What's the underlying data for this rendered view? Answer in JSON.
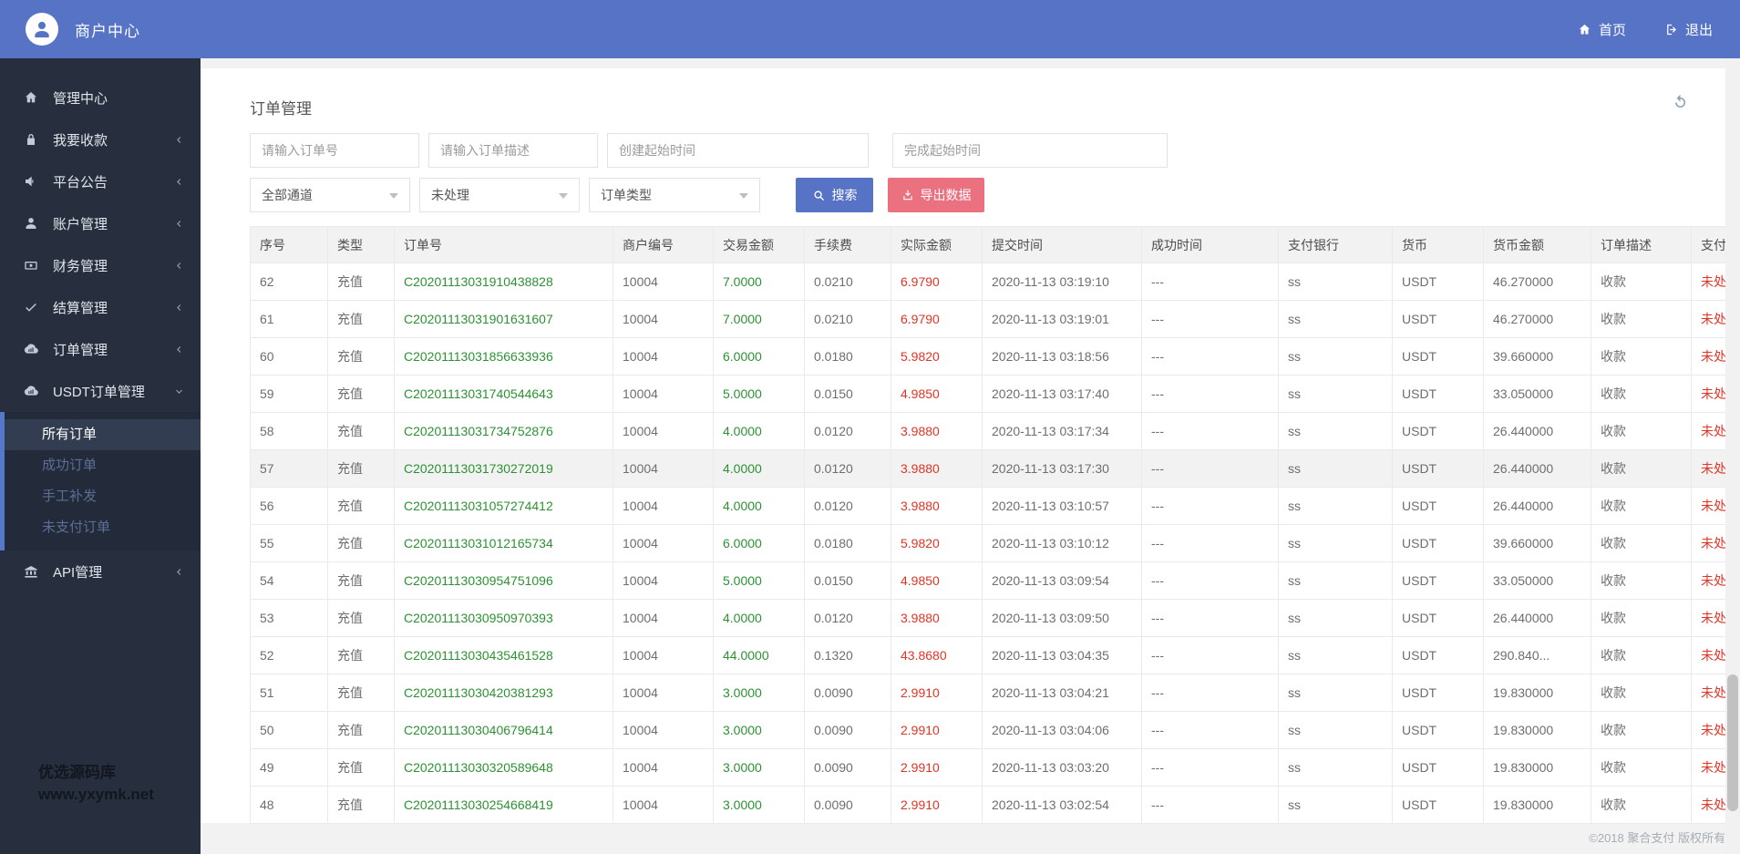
{
  "colors": {
    "header_blue": "#5673c5",
    "sidebar_bg": "#272e3d",
    "submenu_accent": "#5478ca",
    "link_green": "#2d9133",
    "alert_red": "#e03426",
    "export_pink": "#ec7180"
  },
  "header": {
    "brand": "商户中心",
    "nav": [
      {
        "id": "home",
        "label": "首页",
        "icon": "home-icon"
      },
      {
        "id": "logout",
        "label": "退出",
        "icon": "logout-icon"
      }
    ]
  },
  "sidebar": {
    "menu": [
      {
        "id": "management-center",
        "label": "管理中心",
        "icon": "home-icon",
        "arrow": ""
      },
      {
        "id": "receive-payment",
        "label": "我要收款",
        "icon": "lock-icon",
        "arrow": "left"
      },
      {
        "id": "platform-announcement",
        "label": "平台公告",
        "icon": "speaker-icon",
        "arrow": "left"
      },
      {
        "id": "account-management",
        "label": "账户管理",
        "icon": "user-icon",
        "arrow": "left"
      },
      {
        "id": "finance-management",
        "label": "财务管理",
        "icon": "money-icon",
        "arrow": "left"
      },
      {
        "id": "settlement-management",
        "label": "结算管理",
        "icon": "check-icon",
        "arrow": "left"
      },
      {
        "id": "order-management",
        "label": "订单管理",
        "icon": "cloud-icon",
        "arrow": "left"
      },
      {
        "id": "usdt-order-management",
        "label": "USDT订单管理",
        "icon": "cloud-icon",
        "arrow": "down",
        "children": [
          {
            "id": "all-orders",
            "label": "所有订单",
            "active": true
          },
          {
            "id": "success-orders",
            "label": "成功订单",
            "active": false
          },
          {
            "id": "manual-reissue",
            "label": "手工补发",
            "active": false
          },
          {
            "id": "unpaid-orders",
            "label": "未支付订单",
            "active": false
          }
        ]
      },
      {
        "id": "api-management",
        "label": "API管理",
        "icon": "bank-icon",
        "arrow": "left"
      }
    ],
    "watermark": {
      "line1": "优选源码库",
      "line2": "www.yxymk.net"
    }
  },
  "main": {
    "title": "订单管理",
    "filters": {
      "inputs": [
        {
          "id": "order-no",
          "placeholder": "请输入订单号"
        },
        {
          "id": "order-desc",
          "placeholder": "请输入订单描述"
        },
        {
          "id": "create-time",
          "placeholder": "创建起始时间"
        },
        {
          "id": "finish-time",
          "placeholder": "完成起始时间"
        }
      ],
      "selects": [
        {
          "id": "channel",
          "value": "全部通道"
        },
        {
          "id": "status",
          "value": "未处理"
        },
        {
          "id": "type",
          "value": "订单类型"
        }
      ],
      "search_label": "搜索",
      "export_label": "导出数据"
    },
    "table": {
      "columns": [
        "序号",
        "类型",
        "订单号",
        "商户编号",
        "交易金额",
        "手续费",
        "实际金额",
        "提交时间",
        "成功时间",
        "支付银行",
        "货币",
        "货币金额",
        "订单描述",
        "支付状态"
      ],
      "rows": [
        {
          "seq": "62",
          "type": "充值",
          "order_no": "C20201113031910438828",
          "merchant_no": "10004",
          "amount": "7.0000",
          "fee": "0.0210",
          "actual_amount": "6.9790",
          "submit_time": "2020-11-13 03:19:10",
          "success_time": "---",
          "bank": "ss",
          "currency": "USDT",
          "currency_amount": "46.270000",
          "description": "收款",
          "status": "未处理",
          "highlighted": false
        },
        {
          "seq": "61",
          "type": "充值",
          "order_no": "C20201113031901631607",
          "merchant_no": "10004",
          "amount": "7.0000",
          "fee": "0.0210",
          "actual_amount": "6.9790",
          "submit_time": "2020-11-13 03:19:01",
          "success_time": "---",
          "bank": "ss",
          "currency": "USDT",
          "currency_amount": "46.270000",
          "description": "收款",
          "status": "未处理",
          "highlighted": false
        },
        {
          "seq": "60",
          "type": "充值",
          "order_no": "C20201113031856633936",
          "merchant_no": "10004",
          "amount": "6.0000",
          "fee": "0.0180",
          "actual_amount": "5.9820",
          "submit_time": "2020-11-13 03:18:56",
          "success_time": "---",
          "bank": "ss",
          "currency": "USDT",
          "currency_amount": "39.660000",
          "description": "收款",
          "status": "未处理",
          "highlighted": false
        },
        {
          "seq": "59",
          "type": "充值",
          "order_no": "C20201113031740544643",
          "merchant_no": "10004",
          "amount": "5.0000",
          "fee": "0.0150",
          "actual_amount": "4.9850",
          "submit_time": "2020-11-13 03:17:40",
          "success_time": "---",
          "bank": "ss",
          "currency": "USDT",
          "currency_amount": "33.050000",
          "description": "收款",
          "status": "未处理",
          "highlighted": false
        },
        {
          "seq": "58",
          "type": "充值",
          "order_no": "C20201113031734752876",
          "merchant_no": "10004",
          "amount": "4.0000",
          "fee": "0.0120",
          "actual_amount": "3.9880",
          "submit_time": "2020-11-13 03:17:34",
          "success_time": "---",
          "bank": "ss",
          "currency": "USDT",
          "currency_amount": "26.440000",
          "description": "收款",
          "status": "未处理",
          "highlighted": false
        },
        {
          "seq": "57",
          "type": "充值",
          "order_no": "C20201113031730272019",
          "merchant_no": "10004",
          "amount": "4.0000",
          "fee": "0.0120",
          "actual_amount": "3.9880",
          "submit_time": "2020-11-13 03:17:30",
          "success_time": "---",
          "bank": "ss",
          "currency": "USDT",
          "currency_amount": "26.440000",
          "description": "收款",
          "status": "未处理",
          "highlighted": true
        },
        {
          "seq": "56",
          "type": "充值",
          "order_no": "C20201113031057274412",
          "merchant_no": "10004",
          "amount": "4.0000",
          "fee": "0.0120",
          "actual_amount": "3.9880",
          "submit_time": "2020-11-13 03:10:57",
          "success_time": "---",
          "bank": "ss",
          "currency": "USDT",
          "currency_amount": "26.440000",
          "description": "收款",
          "status": "未处理",
          "highlighted": false
        },
        {
          "seq": "55",
          "type": "充值",
          "order_no": "C20201113031012165734",
          "merchant_no": "10004",
          "amount": "6.0000",
          "fee": "0.0180",
          "actual_amount": "5.9820",
          "submit_time": "2020-11-13 03:10:12",
          "success_time": "---",
          "bank": "ss",
          "currency": "USDT",
          "currency_amount": "39.660000",
          "description": "收款",
          "status": "未处理",
          "highlighted": false
        },
        {
          "seq": "54",
          "type": "充值",
          "order_no": "C20201113030954751096",
          "merchant_no": "10004",
          "amount": "5.0000",
          "fee": "0.0150",
          "actual_amount": "4.9850",
          "submit_time": "2020-11-13 03:09:54",
          "success_time": "---",
          "bank": "ss",
          "currency": "USDT",
          "currency_amount": "33.050000",
          "description": "收款",
          "status": "未处理",
          "highlighted": false
        },
        {
          "seq": "53",
          "type": "充值",
          "order_no": "C20201113030950970393",
          "merchant_no": "10004",
          "amount": "4.0000",
          "fee": "0.0120",
          "actual_amount": "3.9880",
          "submit_time": "2020-11-13 03:09:50",
          "success_time": "---",
          "bank": "ss",
          "currency": "USDT",
          "currency_amount": "26.440000",
          "description": "收款",
          "status": "未处理",
          "highlighted": false
        },
        {
          "seq": "52",
          "type": "充值",
          "order_no": "C20201113030435461528",
          "merchant_no": "10004",
          "amount": "44.0000",
          "fee": "0.1320",
          "actual_amount": "43.8680",
          "submit_time": "2020-11-13 03:04:35",
          "success_time": "---",
          "bank": "ss",
          "currency": "USDT",
          "currency_amount": "290.840...",
          "description": "收款",
          "status": "未处理",
          "highlighted": false
        },
        {
          "seq": "51",
          "type": "充值",
          "order_no": "C20201113030420381293",
          "merchant_no": "10004",
          "amount": "3.0000",
          "fee": "0.0090",
          "actual_amount": "2.9910",
          "submit_time": "2020-11-13 03:04:21",
          "success_time": "---",
          "bank": "ss",
          "currency": "USDT",
          "currency_amount": "19.830000",
          "description": "收款",
          "status": "未处理",
          "highlighted": false
        },
        {
          "seq": "50",
          "type": "充值",
          "order_no": "C20201113030406796414",
          "merchant_no": "10004",
          "amount": "3.0000",
          "fee": "0.0090",
          "actual_amount": "2.9910",
          "submit_time": "2020-11-13 03:04:06",
          "success_time": "---",
          "bank": "ss",
          "currency": "USDT",
          "currency_amount": "19.830000",
          "description": "收款",
          "status": "未处理",
          "highlighted": false
        },
        {
          "seq": "49",
          "type": "充值",
          "order_no": "C20201113030320589648",
          "merchant_no": "10004",
          "amount": "3.0000",
          "fee": "0.0090",
          "actual_amount": "2.9910",
          "submit_time": "2020-11-13 03:03:20",
          "success_time": "---",
          "bank": "ss",
          "currency": "USDT",
          "currency_amount": "19.830000",
          "description": "收款",
          "status": "未处理",
          "highlighted": false
        },
        {
          "seq": "48",
          "type": "充值",
          "order_no": "C20201113030254668419",
          "merchant_no": "10004",
          "amount": "3.0000",
          "fee": "0.0090",
          "actual_amount": "2.9910",
          "submit_time": "2020-11-13 03:02:54",
          "success_time": "---",
          "bank": "ss",
          "currency": "USDT",
          "currency_amount": "19.830000",
          "description": "收款",
          "status": "未处理",
          "highlighted": false
        }
      ]
    }
  },
  "footer": "©2018 聚合支付 版权所有"
}
